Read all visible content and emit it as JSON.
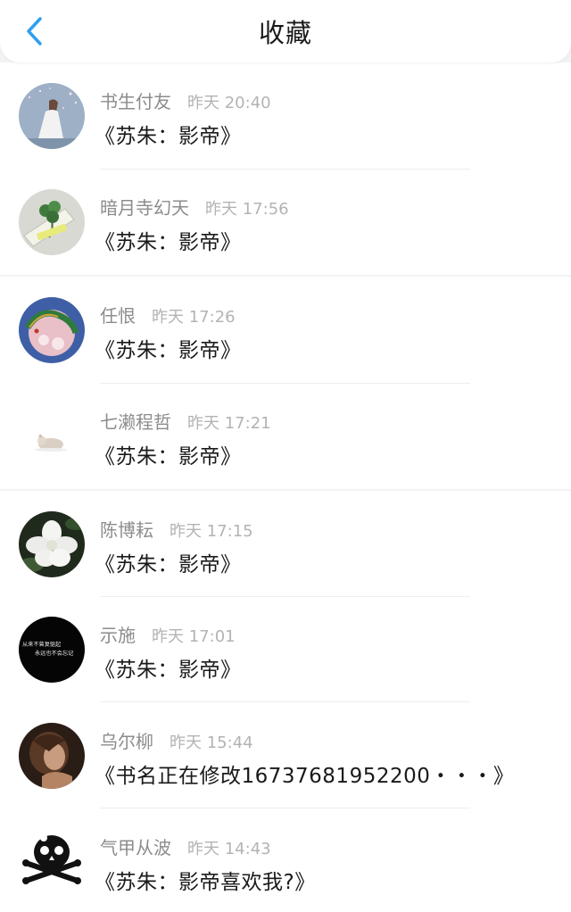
{
  "header": {
    "title": "收藏",
    "back_icon": "chevron-left-icon",
    "accent_color": "#2f9ef2"
  },
  "items": [
    {
      "name": "书生付友",
      "time": "昨天 20:40",
      "message": "《苏朱：影帝》",
      "avatar": "girl-in-white-dress-avatar"
    },
    {
      "name": "暗月寺幻天",
      "time": "昨天 17:56",
      "message": "《苏朱：影帝》",
      "avatar": "clover-leaf-avatar"
    },
    {
      "name": "任恨",
      "time": "昨天 17:26",
      "message": "《苏朱：影帝》",
      "avatar": "dragon-pattern-avatar"
    },
    {
      "name": "七濑程哲",
      "time": "昨天 17:21",
      "message": "《苏朱：影帝》",
      "avatar": "small-animal-avatar"
    },
    {
      "name": "陈博耘",
      "time": "昨天 17:15",
      "message": "《苏朱：影帝》",
      "avatar": "white-flower-avatar"
    },
    {
      "name": "示施",
      "time": "昨天 17:01",
      "message": "《苏朱：影帝》",
      "avatar": "black-text-avatar",
      "avatar_text": [
        "从来不曾复驱起",
        "永远也不会忘记"
      ]
    },
    {
      "name": "乌尔柳",
      "time": "昨天 15:44",
      "message": "《书名正在修改16737681952200・・・》",
      "avatar": "vintage-portrait-avatar"
    },
    {
      "name": "气甲从波",
      "time": "昨天 14:43",
      "message": "《苏朱：影帝喜欢我?》",
      "avatar": "skull-crossbones-avatar"
    }
  ]
}
